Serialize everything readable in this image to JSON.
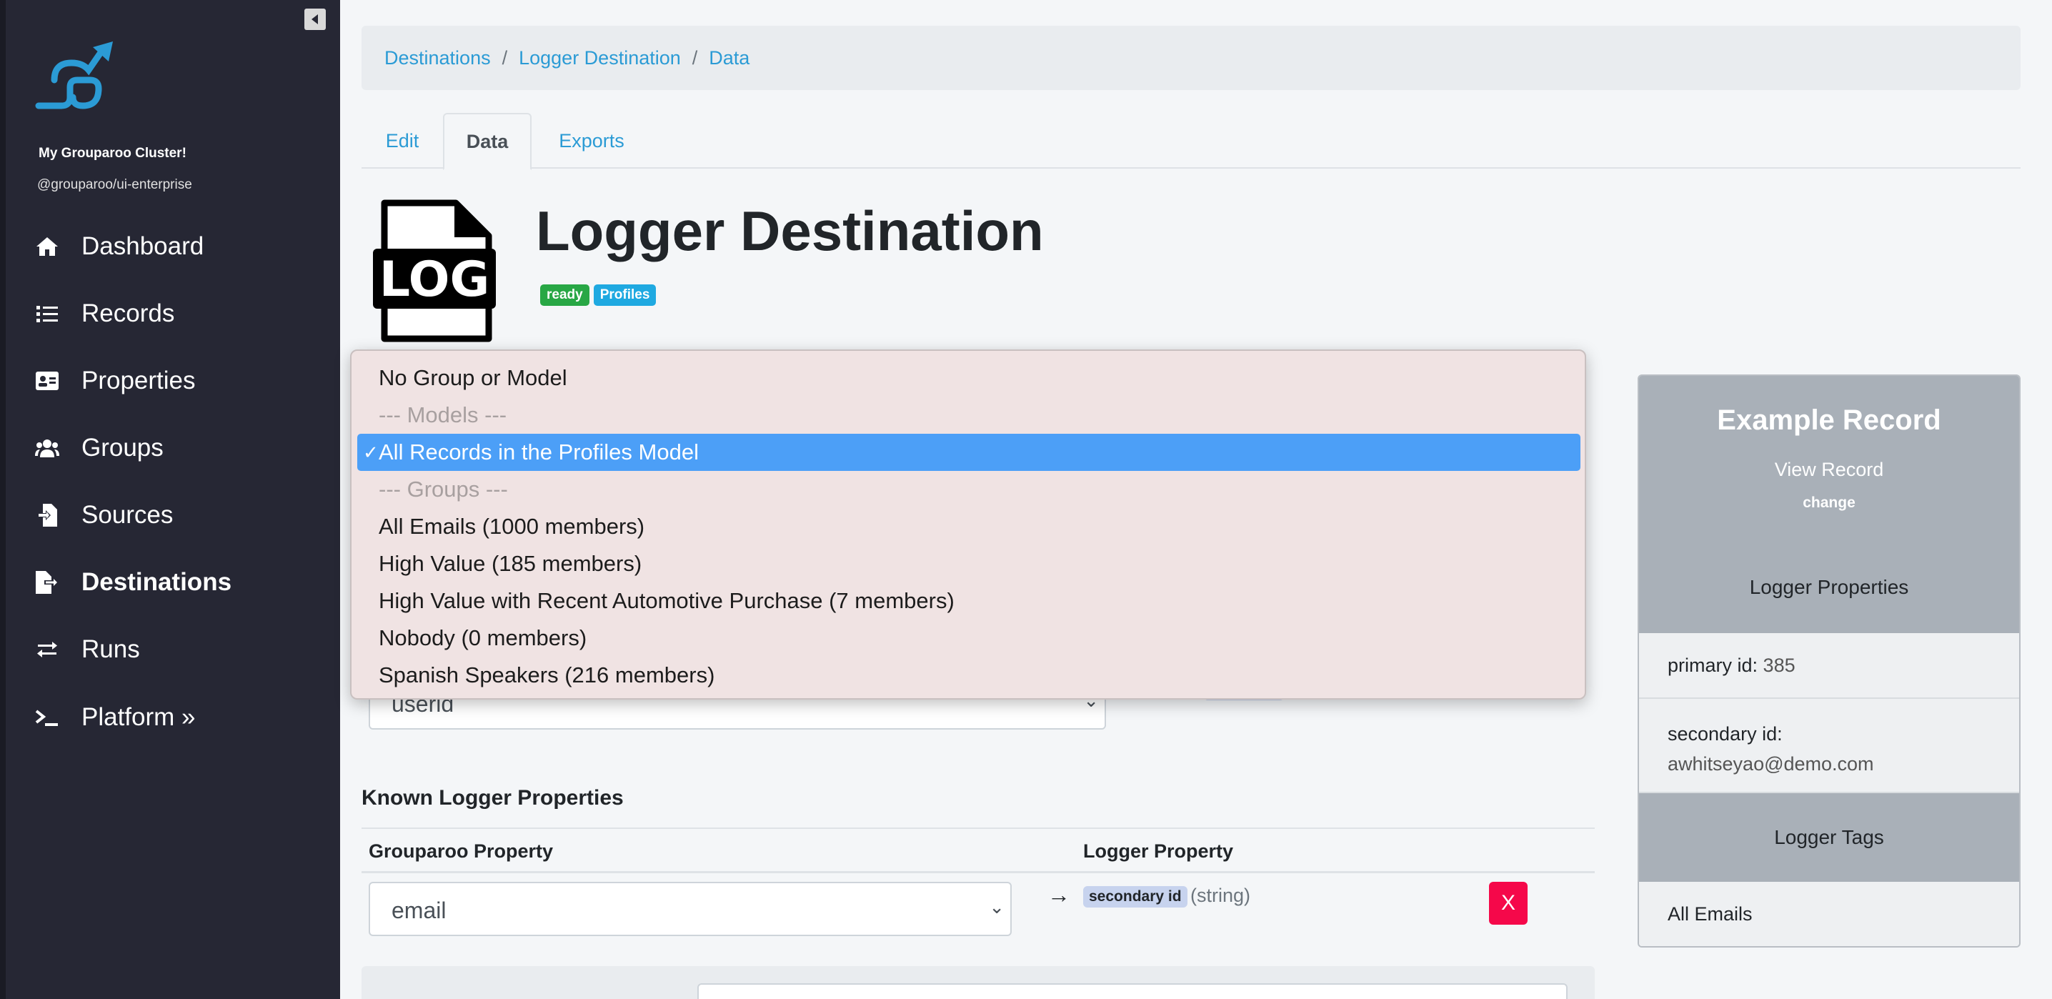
{
  "sidebar": {
    "cluster_name": "My Grouparoo Cluster!",
    "package": "@grouparoo/ui-enterprise",
    "items": [
      {
        "label": "Dashboard",
        "icon": "home-icon"
      },
      {
        "label": "Records",
        "icon": "list-icon"
      },
      {
        "label": "Properties",
        "icon": "id-card-icon"
      },
      {
        "label": "Groups",
        "icon": "users-icon"
      },
      {
        "label": "Sources",
        "icon": "file-import-icon"
      },
      {
        "label": "Destinations",
        "icon": "file-export-icon",
        "active": true
      },
      {
        "label": "Runs",
        "icon": "exchange-icon"
      },
      {
        "label": "Platform »",
        "icon": "terminal-icon"
      }
    ]
  },
  "breadcrumb": [
    "Destinations",
    "Logger Destination",
    "Data"
  ],
  "tabs": [
    {
      "label": "Edit"
    },
    {
      "label": "Data",
      "active": true
    },
    {
      "label": "Exports"
    }
  ],
  "destination": {
    "title": "Logger Destination",
    "icon_text": "LOG",
    "badges": [
      "ready",
      "Profiles"
    ]
  },
  "dropdown": {
    "selected_index": 2,
    "check_mark": "✓",
    "options": [
      {
        "label": "No Group or Model",
        "disabled": false
      },
      {
        "label": "--- Models ---",
        "disabled": true
      },
      {
        "label": "All Records in the Profiles Model",
        "disabled": false
      },
      {
        "label": "--- Groups ---",
        "disabled": true
      },
      {
        "label": "All Emails (1000 members)",
        "disabled": false
      },
      {
        "label": "High Value (185 members)",
        "disabled": false
      },
      {
        "label": "High Value with Recent Automotive Purchase (7 members)",
        "disabled": false
      },
      {
        "label": "Nobody (0 members)",
        "disabled": false
      },
      {
        "label": "Spanish Speakers (216 members)",
        "disabled": false
      }
    ]
  },
  "id_mapping": {
    "select_value": "userid"
  },
  "known_properties": {
    "title": "Known Logger Properties",
    "col_grouparoo": "Grouparoo Property",
    "col_logger": "Logger Property",
    "rows": [
      {
        "grouparoo": "email",
        "arrow": "→",
        "logger": "secondary id",
        "type": "(string)",
        "remove": "X"
      }
    ]
  },
  "example_record": {
    "title": "Example Record",
    "view_link": "View Record",
    "change": "change",
    "properties_title": "Logger Properties",
    "properties": [
      {
        "key": "primary id:",
        "value": "385"
      },
      {
        "key": "secondary id:",
        "value": "awhitseyao@demo.com"
      }
    ],
    "tags_title": "Logger Tags",
    "tags": [
      "All Emails"
    ]
  },
  "colors": {
    "sidebar_bg": "#262734",
    "link": "#2b9bd5",
    "selected_option": "#4c9ff7",
    "danger": "#f5084a",
    "badge_ready": "#28a745",
    "badge_profiles": "#1fa9e1"
  }
}
